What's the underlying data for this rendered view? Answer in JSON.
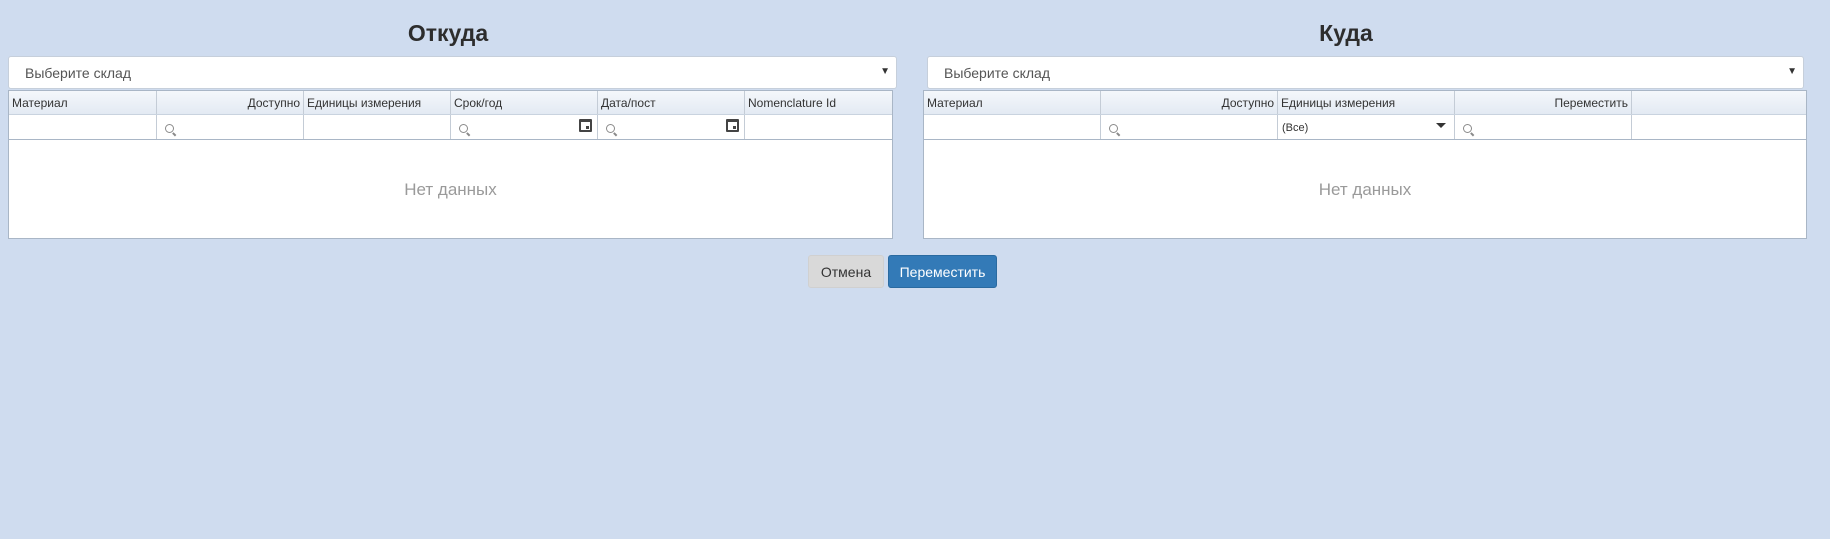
{
  "from": {
    "title": "Откуда",
    "warehouse_select": {
      "placeholder": "Выберите склад"
    },
    "columns": [
      "Материал",
      "Доступно",
      "Единицы измерения",
      "Срок/год",
      "Дата/пост",
      "Nomenclature Id"
    ],
    "empty_text": "Нет данных"
  },
  "to": {
    "title": "Куда",
    "warehouse_select": {
      "placeholder": "Выберите склад"
    },
    "columns": [
      "Материал",
      "Доступно",
      "Единицы измерения",
      "Переместить",
      ""
    ],
    "unit_filter_value": "(Все)",
    "empty_text": "Нет данных"
  },
  "actions": {
    "cancel_label": "Отмена",
    "move_label": "Переместить"
  },
  "colors": {
    "background": "#cfdcef",
    "primary": "#337ab7"
  }
}
